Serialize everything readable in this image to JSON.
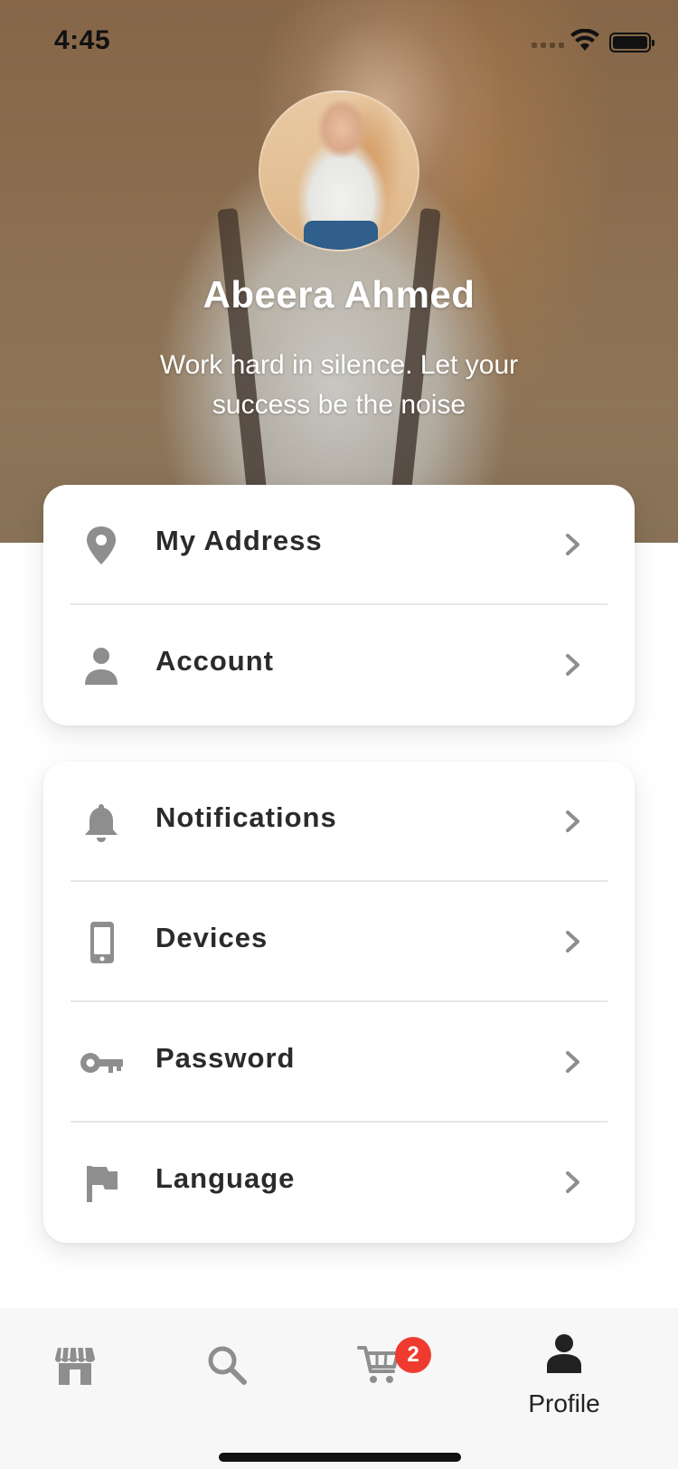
{
  "status_bar": {
    "time": "4:45"
  },
  "profile": {
    "name": "Abeera Ahmed",
    "quote": "Work hard in silence. Let your success be the noise"
  },
  "menu_group_1": [
    {
      "label": "My Address",
      "icon": "location-pin-icon"
    },
    {
      "label": "Account",
      "icon": "person-icon"
    }
  ],
  "menu_group_2": [
    {
      "label": "Notifications",
      "icon": "bell-icon"
    },
    {
      "label": "Devices",
      "icon": "phone-icon"
    },
    {
      "label": "Password",
      "icon": "key-icon"
    },
    {
      "label": "Language",
      "icon": "flag-icon"
    }
  ],
  "tab_bar": {
    "store": {
      "icon": "store-icon"
    },
    "search": {
      "icon": "search-icon"
    },
    "cart": {
      "icon": "cart-icon",
      "badge": "2"
    },
    "profile": {
      "icon": "person-icon",
      "label": "Profile",
      "active": true
    }
  },
  "colors": {
    "icon_gray": "#8e8e8e",
    "text_dark": "#2b2b2b",
    "badge_red": "#ef3b2f",
    "tab_bar_bg": "#f7f7f7"
  }
}
